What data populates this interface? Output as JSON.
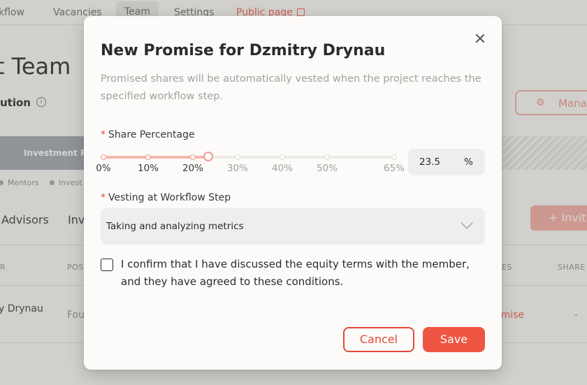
{
  "nav": {
    "items": [
      "kflow",
      "Vacancies",
      "Team",
      "Settings"
    ],
    "public_page": "Public page"
  },
  "page": {
    "title": "t Team",
    "section": "ution",
    "manage_label": "Mana",
    "invest_bar": "Investment Res",
    "legend": [
      "Mentors",
      "Invest"
    ],
    "tabs": [
      "Advisors",
      "Inv"
    ],
    "invite_label": "Invit",
    "table_headers": [
      "R",
      "POS",
      "ES",
      "SHARE"
    ],
    "row": {
      "name": "y Drynau",
      "position": "Fou",
      "action": "omise",
      "share": "-"
    }
  },
  "modal": {
    "title": "New Promise for Dzmitry Drynau",
    "description": "Promised shares will be automatically vested when the project reaches the specified workflow step.",
    "share_label": "Share Percentage",
    "required_mark": "*",
    "slider": {
      "marks": [
        "0%",
        "10%",
        "20%",
        "30%",
        "40%",
        "50%",
        "65%"
      ],
      "mark_values": [
        0,
        10,
        20,
        30,
        40,
        50,
        65
      ],
      "value": 23.5,
      "min": 0,
      "max": 65
    },
    "percentage_value": "23.5",
    "percentage_unit": "%",
    "vesting_label": "Vesting at Workflow Step",
    "vesting_value": "Taking and analyzing metrics",
    "confirm_text": "I confirm that I have discussed the equity terms with the member, and they have agreed to these conditions.",
    "cancel_label": "Cancel",
    "save_label": "Save"
  },
  "colors": {
    "accent": "#ef5543",
    "accent_light": "#f5b8af",
    "modal_bg": "#fcfbf9",
    "field_bg": "#efeeec"
  }
}
